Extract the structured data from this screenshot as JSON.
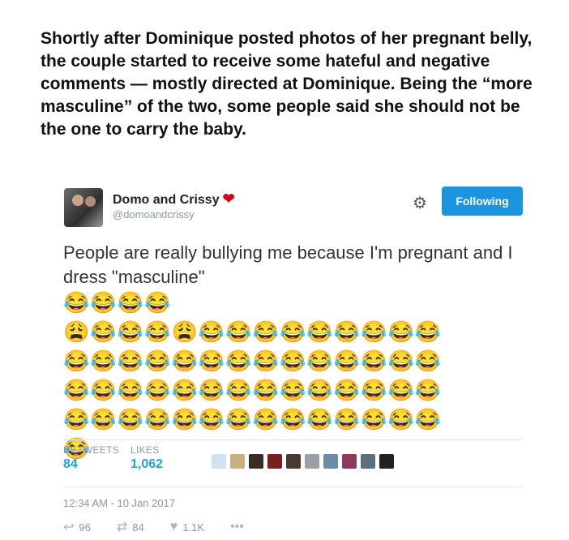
{
  "headline": "Shortly after Dominique posted photos of her pregnant belly, the couple started to receive some hateful and negative comments — mostly directed at Dominique. Being the “more masculine” of the two, some people said she should not be the one to carry the baby.",
  "tweet": {
    "name": "Domo and Crissy",
    "heart": "❤",
    "handle": "@domoandcrissy",
    "follow_label": "Following",
    "text": "People are really bullying me because I'm pregnant and I dress \"masculine\"",
    "emojis": "😂😂😂😂\n😩😂😂😂😩😂😂😂😂😂😂😂😂😂\n😂😂😂😂😂😂😂😂😂😂😂😂😂😂\n😂😂😂😂😂😂😂😂😂😂😂😂😂😂\n😂😂😂😂😂😂😂😂😂😂😂😂😂😂\n😂",
    "retweets_label": "RETWEETS",
    "retweets_count": "84",
    "likes_label": "LIKES",
    "likes_count": "1,062",
    "timestamp": "12:34 AM - 10 Jan 2017",
    "reply_count": "96",
    "retweet_count": "84",
    "like_count": "1.1K"
  },
  "colors": {
    "accent": "#1b95e0",
    "heart": "#d0021b",
    "muted": "#8899a6"
  },
  "icons": {
    "settings": "gear-icon",
    "reply": "reply-icon",
    "retweet": "retweet-icon",
    "like": "heart-icon",
    "more": "more-icon"
  }
}
